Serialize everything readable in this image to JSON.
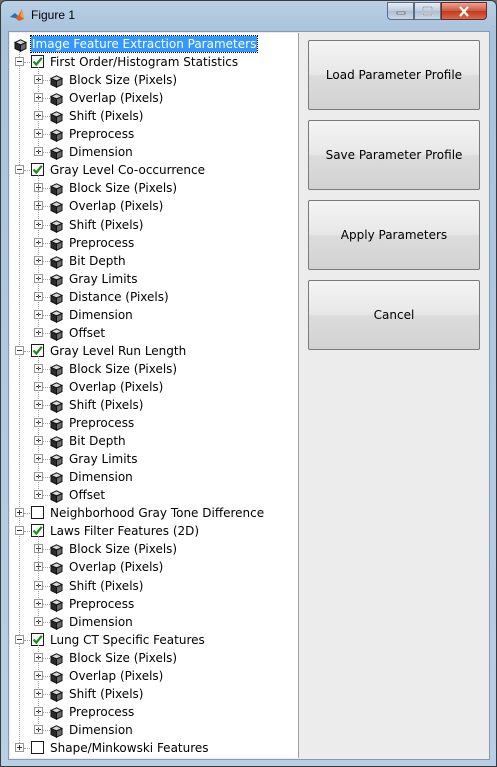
{
  "window": {
    "title": "Figure 1"
  },
  "tree": {
    "root": {
      "label": "Image Feature Extraction Parameters"
    },
    "groups": [
      {
        "label": "First Order/Histogram Statistics",
        "checked": true,
        "children": [
          "Block Size (Pixels)",
          "Overlap (Pixels)",
          "Shift (Pixels)",
          "Preprocess",
          "Dimension"
        ]
      },
      {
        "label": "Gray Level Co-occurrence",
        "checked": true,
        "children": [
          "Block Size (Pixels)",
          "Overlap (Pixels)",
          "Shift (Pixels)",
          "Preprocess",
          "Bit Depth",
          "Gray Limits",
          "Distance (Pixels)",
          "Dimension",
          "Offset"
        ]
      },
      {
        "label": "Gray Level Run Length",
        "checked": true,
        "children": [
          "Block Size (Pixels)",
          "Overlap (Pixels)",
          "Shift (Pixels)",
          "Preprocess",
          "Bit Depth",
          "Gray Limits",
          "Dimension",
          "Offset"
        ]
      },
      {
        "label": "Neighborhood Gray Tone Difference",
        "checked": false,
        "children": []
      },
      {
        "label": "Laws Filter Features (2D)",
        "checked": true,
        "children": [
          "Block Size (Pixels)",
          "Overlap (Pixels)",
          "Shift (Pixels)",
          "Preprocess",
          "Dimension"
        ]
      },
      {
        "label": "Lung CT Specific Features",
        "checked": true,
        "children": [
          "Block Size (Pixels)",
          "Overlap (Pixels)",
          "Shift (Pixels)",
          "Preprocess",
          "Dimension"
        ]
      },
      {
        "label": "Shape/Minkowski Features",
        "checked": false,
        "children": []
      }
    ]
  },
  "buttons": {
    "load": "Load Parameter Profile",
    "save": "Save Parameter Profile",
    "apply": "Apply Parameters",
    "cancel": "Cancel"
  },
  "colors": {
    "selection": "#3399ff",
    "check": "#1a8a1a",
    "close": "#c23a1f"
  }
}
